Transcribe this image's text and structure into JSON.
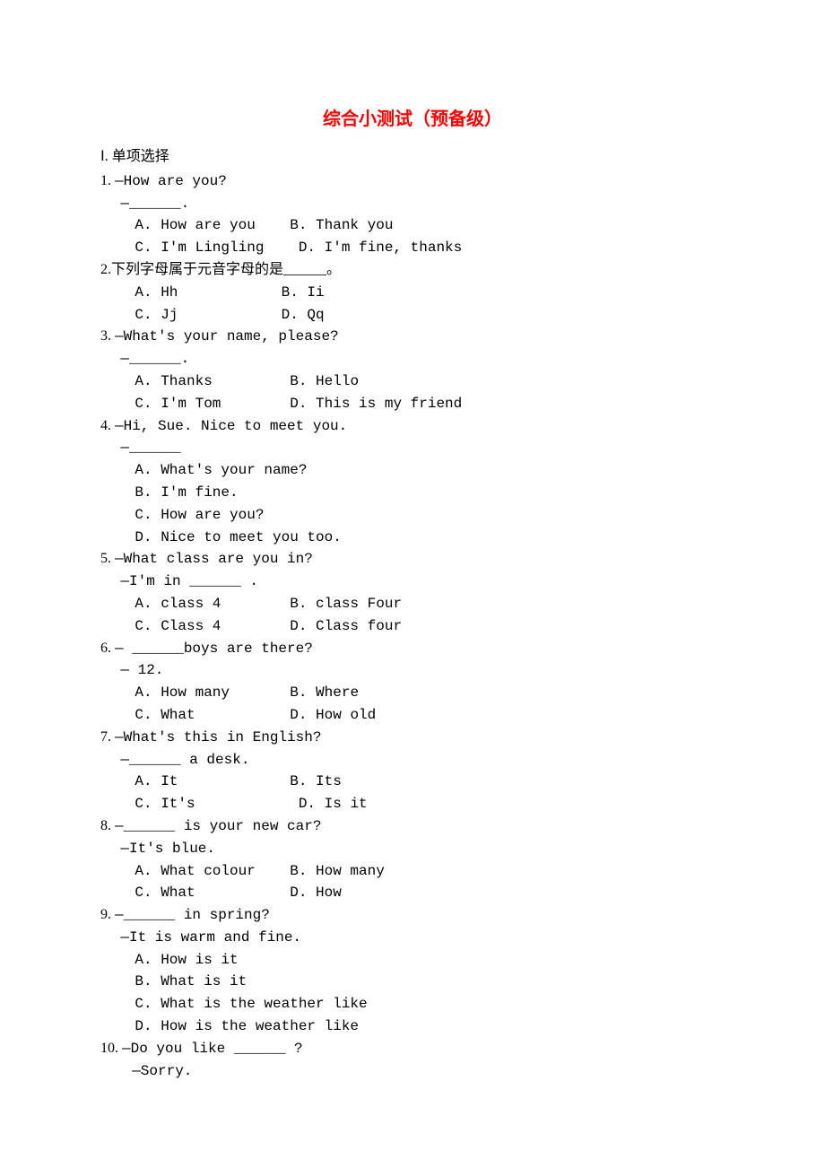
{
  "title": "综合小测试（预备级）",
  "section": "Ⅰ. 单项选择",
  "questions": [
    {
      "num": "1.",
      "prompt1": "—How are you?",
      "prompt2": "—______.",
      "optA": "A. How are you",
      "optB": "B. Thank you",
      "optC": "C. I'm Lingling",
      "optD": "D. I'm fine, thanks"
    },
    {
      "num": "2.",
      "prompt1": "下列字母属于元音字母的是______。",
      "optA": "A. Hh",
      "optB": "B. Ii",
      "optC": "C. Jj",
      "optD": "D. Qq"
    },
    {
      "num": "3.",
      "prompt1": "—What's your name, please?",
      "prompt2": "—______.",
      "optA": "A. Thanks",
      "optB": "B. Hello",
      "optC": "C. I'm Tom",
      "optD": "D. This is my friend"
    },
    {
      "num": "4.",
      "prompt1": "—Hi, Sue. Nice to meet you.",
      "prompt2": "—______",
      "optA": "A. What's your name?",
      "optB": "B. I'm fine.",
      "optC": "C. How are you?",
      "optD": "D. Nice to meet you too."
    },
    {
      "num": "5.",
      "prompt1": "—What class are you in?",
      "prompt2": "—I'm in ______ .",
      "optA": "A. class 4",
      "optB": "B. class Four",
      "optC": "C. Class 4",
      "optD": "D. Class four"
    },
    {
      "num": "6.",
      "prompt1": "— ______boys are there?",
      "prompt2": "— 12.",
      "optA": "A. How many",
      "optB": "B. Where",
      "optC": "C. What",
      "optD": "D. How old"
    },
    {
      "num": "7.",
      "prompt1": "—What's this in English?",
      "prompt2": "—______ a desk.",
      "optA": "A. It",
      "optB": "B. Its",
      "optC": "C. It's",
      "optD": "D. Is it"
    },
    {
      "num": "8.",
      "prompt1": "—______ is your new car?",
      "prompt2": "—It's blue.",
      "optA": "A. What colour",
      "optB": "B. How many",
      "optC": "C. What",
      "optD": "D. How"
    },
    {
      "num": "9.",
      "prompt1": "—______ in spring?",
      "prompt2": "—It is warm and fine.",
      "optA": "A. How is it",
      "optB": "B. What is it",
      "optC": "C. What is the weather like",
      "optD": "D. How is the weather like"
    },
    {
      "num": "10.",
      "prompt1": "—Do you like ______ ?",
      "prompt2": "—Sorry.",
      "optA": "",
      "optB": "",
      "optC": "",
      "optD": ""
    }
  ]
}
